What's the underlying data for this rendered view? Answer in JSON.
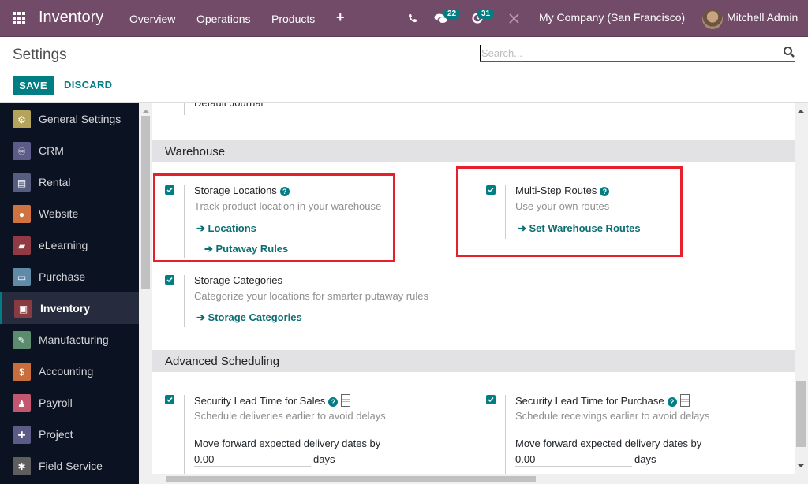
{
  "navbar": {
    "app_title": "Inventory",
    "menu": [
      "Overview",
      "Operations",
      "Products"
    ],
    "add_icon": "plus-icon",
    "phone_icon": "phone-icon",
    "messages_icon": "chat-icon",
    "messages_count": "22",
    "activity_icon": "clock-icon",
    "activity_count": "31",
    "debug_icon": "tools-icon",
    "company": "My Company (San Francisco)",
    "user": "Mitchell Admin"
  },
  "control_panel": {
    "title": "Settings",
    "search_placeholder": "Search...",
    "save_label": "SAVE",
    "discard_label": "DISCARD"
  },
  "sidebar": {
    "items": [
      {
        "label": "General Settings",
        "icon": "gear-icon",
        "color": "#b5a35a",
        "active": false
      },
      {
        "label": "CRM",
        "icon": "handshake-icon",
        "color": "#5d5b88",
        "active": false
      },
      {
        "label": "Rental",
        "icon": "calendar-icon",
        "color": "#575d7e",
        "active": false
      },
      {
        "label": "Website",
        "icon": "globe-icon",
        "color": "#cf7440",
        "active": false
      },
      {
        "label": "eLearning",
        "icon": "elearning-icon",
        "color": "#8f3a44",
        "active": false
      },
      {
        "label": "Purchase",
        "icon": "credit-card-icon",
        "color": "#5f8aa8",
        "active": false
      },
      {
        "label": "Inventory",
        "icon": "box-icon",
        "color": "#8a3a41",
        "active": true
      },
      {
        "label": "Manufacturing",
        "icon": "wrench-icon",
        "color": "#5b8c6e",
        "active": false
      },
      {
        "label": "Accounting",
        "icon": "invoice-icon",
        "color": "#c86e3c",
        "active": false
      },
      {
        "label": "Payroll",
        "icon": "payroll-icon",
        "color": "#c2576f",
        "active": false
      },
      {
        "label": "Project",
        "icon": "puzzle-icon",
        "color": "#5b5b85",
        "active": false
      },
      {
        "label": "Field Service",
        "icon": "field-service-icon",
        "color": "#5e5e5e",
        "active": false
      }
    ]
  },
  "content": {
    "default_journal_label": "Default Journal",
    "warehouse": {
      "heading": "Warehouse",
      "storage_locations": {
        "title": "Storage Locations",
        "checked": true,
        "description": "Track product location in your warehouse",
        "links": [
          "Locations",
          "Putaway Rules"
        ]
      },
      "multi_step_routes": {
        "title": "Multi-Step Routes",
        "checked": true,
        "description": "Use your own routes",
        "links": [
          "Set Warehouse Routes"
        ]
      },
      "storage_categories": {
        "title": "Storage Categories",
        "checked": true,
        "description": "Categorize your locations for smarter putaway rules",
        "links": [
          "Storage Categories"
        ]
      }
    },
    "advanced_scheduling": {
      "heading": "Advanced Scheduling",
      "sales": {
        "title": "Security Lead Time for Sales",
        "checked": true,
        "description": "Schedule deliveries earlier to avoid delays",
        "field_label": "Move forward expected delivery dates by",
        "value": "0.00",
        "unit": "days"
      },
      "purchase": {
        "title": "Security Lead Time for Purchase",
        "checked": true,
        "description": "Schedule receivings earlier to avoid delays",
        "field_label": "Move forward expected delivery dates by",
        "value": "0.00",
        "unit": "days"
      }
    }
  },
  "colors": {
    "navbar": "#714b67",
    "accent": "#017e84",
    "highlight_box": "#e5202c",
    "sidebar_bg": "#0b1222"
  }
}
